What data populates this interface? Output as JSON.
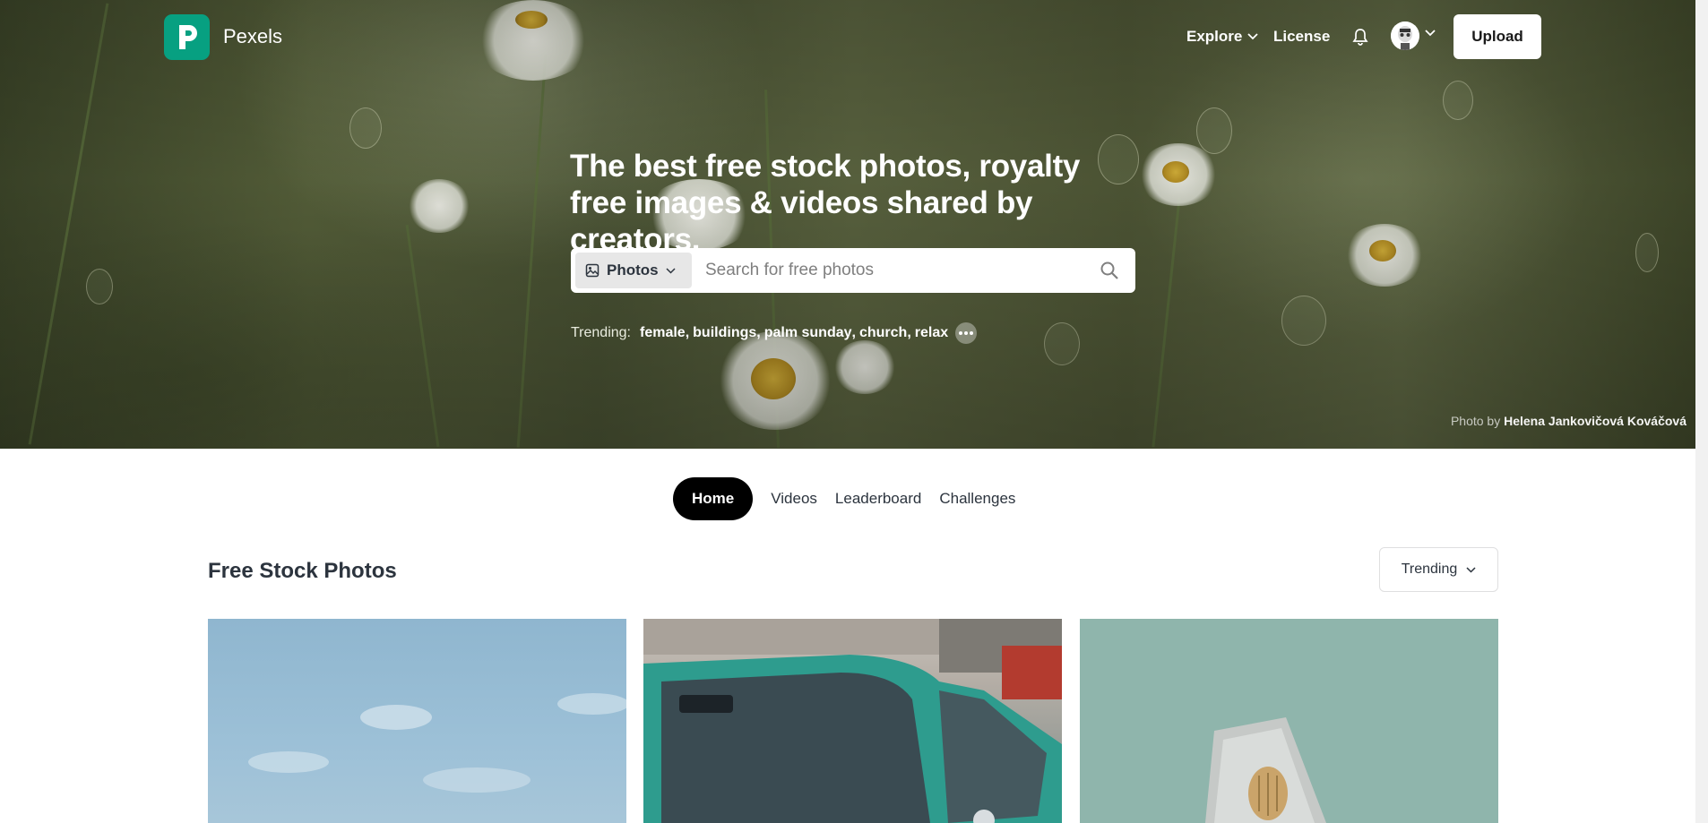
{
  "brand": {
    "name": "Pexels"
  },
  "nav": {
    "explore": "Explore",
    "license": "License",
    "upload": "Upload"
  },
  "hero": {
    "headline": "The best free stock photos, royalty free images & videos shared by creators.",
    "search": {
      "type_label": "Photos",
      "placeholder": "Search for free photos"
    },
    "trending": {
      "label": "Trending:",
      "items": [
        "female",
        "buildings",
        "palm sunday",
        "church",
        "relax"
      ]
    },
    "credit": {
      "prefix": "Photo by",
      "author": "Helena Jankovičová Kováčová"
    }
  },
  "tabs": [
    {
      "label": "Home",
      "active": true
    },
    {
      "label": "Videos",
      "active": false
    },
    {
      "label": "Leaderboard",
      "active": false
    },
    {
      "label": "Challenges",
      "active": false
    }
  ],
  "feed": {
    "title": "Free Stock Photos",
    "sort": "Trending"
  },
  "colors": {
    "brand_green": "#07a081",
    "active_tab": "#000000",
    "text_dark": "#2c343e"
  }
}
